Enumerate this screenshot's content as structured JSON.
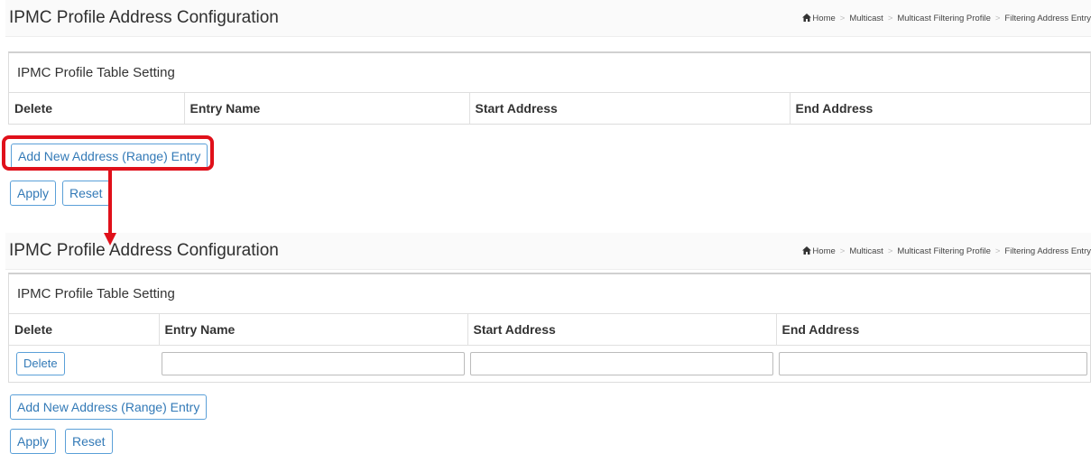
{
  "panels": [
    {
      "title": "IPMC Profile Address Configuration",
      "breadcrumb": [
        "Home",
        "Multicast",
        "Multicast Filtering Profile",
        "Filtering Address Entry"
      ],
      "table_caption": "IPMC Profile Table Setting",
      "columns": [
        "Delete",
        "Entry Name",
        "Start Address",
        "End Address"
      ],
      "rows": [],
      "add_button": "Add New Address (Range) Entry",
      "apply_button": "Apply",
      "reset_button": "Reset"
    },
    {
      "title": "IPMC Profile Address Configuration",
      "breadcrumb": [
        "Home",
        "Multicast",
        "Multicast Filtering Profile",
        "Filtering Address Entry"
      ],
      "table_caption": "IPMC Profile Table Setting",
      "columns": [
        "Delete",
        "Entry Name",
        "Start Address",
        "End Address"
      ],
      "rows": [
        {
          "delete_button": "Delete",
          "entry_name": "",
          "start_address": "",
          "end_address": ""
        }
      ],
      "add_button": "Add New Address (Range) Entry",
      "apply_button": "Apply",
      "reset_button": "Reset"
    }
  ],
  "annotation": {
    "highlight_color": "#e0101a",
    "arrow_color": "#e0101a"
  },
  "colors": {
    "button_border": "#5ba0d8",
    "button_text": "#337ab7"
  }
}
